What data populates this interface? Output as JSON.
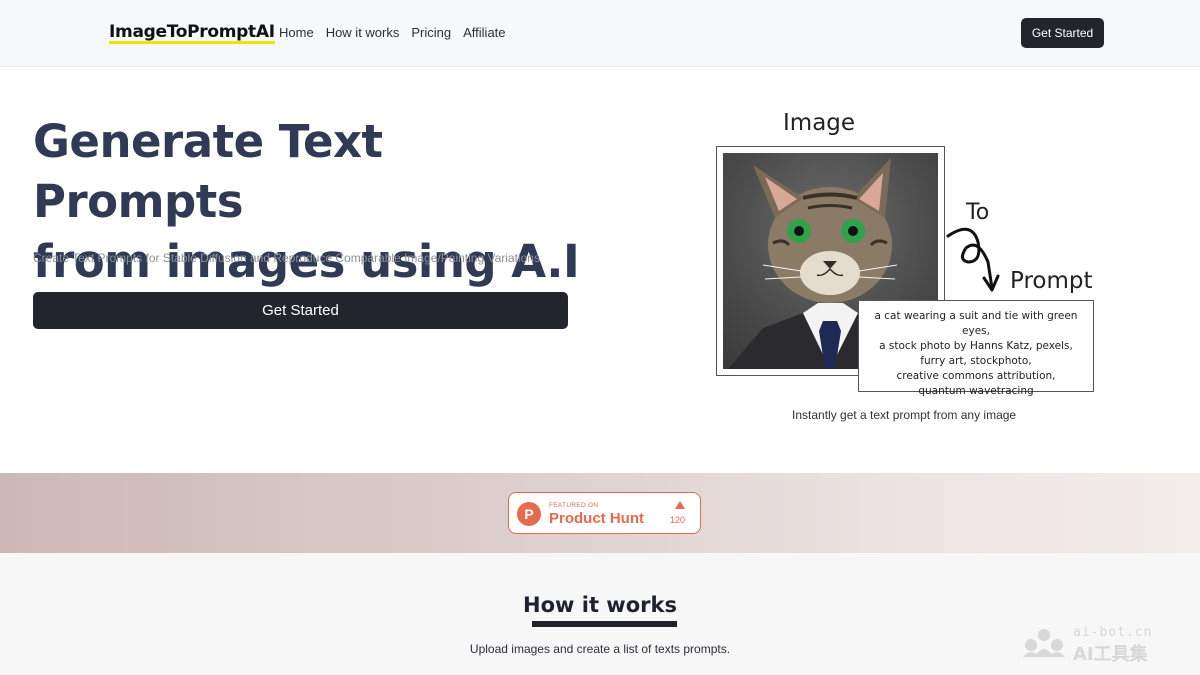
{
  "nav": {
    "logo": "ImageToPromptAI",
    "links": [
      "Home",
      "How it works",
      "Pricing",
      "Affiliate"
    ],
    "cta": "Get Started"
  },
  "hero": {
    "title_line1": "Generate Text Prompts",
    "title_line2": "from images using A.I",
    "subtitle": "Create Text Prompts for Stable Diffusion and Reproduce Comparable Image/Painting Variations",
    "cta": "Get Started"
  },
  "illustration": {
    "label_image": "Image",
    "label_to": "To",
    "label_prompt": "Prompt",
    "prompt_lines": [
      "a cat wearing a suit and tie with green eyes,",
      "a stock photo by Hanns Katz, pexels,",
      "furry art, stockphoto,",
      "creative commons attribution,",
      "quantum wavetracing"
    ],
    "caption": "Instantly get a text prompt from any image"
  },
  "product_hunt": {
    "featured_on": "FEATURED ON",
    "name": "Product Hunt",
    "logo_letter": "P",
    "upvotes": "120",
    "color": "#e66a4e"
  },
  "how_it_works": {
    "title": "How it works",
    "subtitle": "Upload images and create a list of texts prompts."
  },
  "watermark": {
    "domain": "ai-bot.cn",
    "name": "AI工具集"
  }
}
